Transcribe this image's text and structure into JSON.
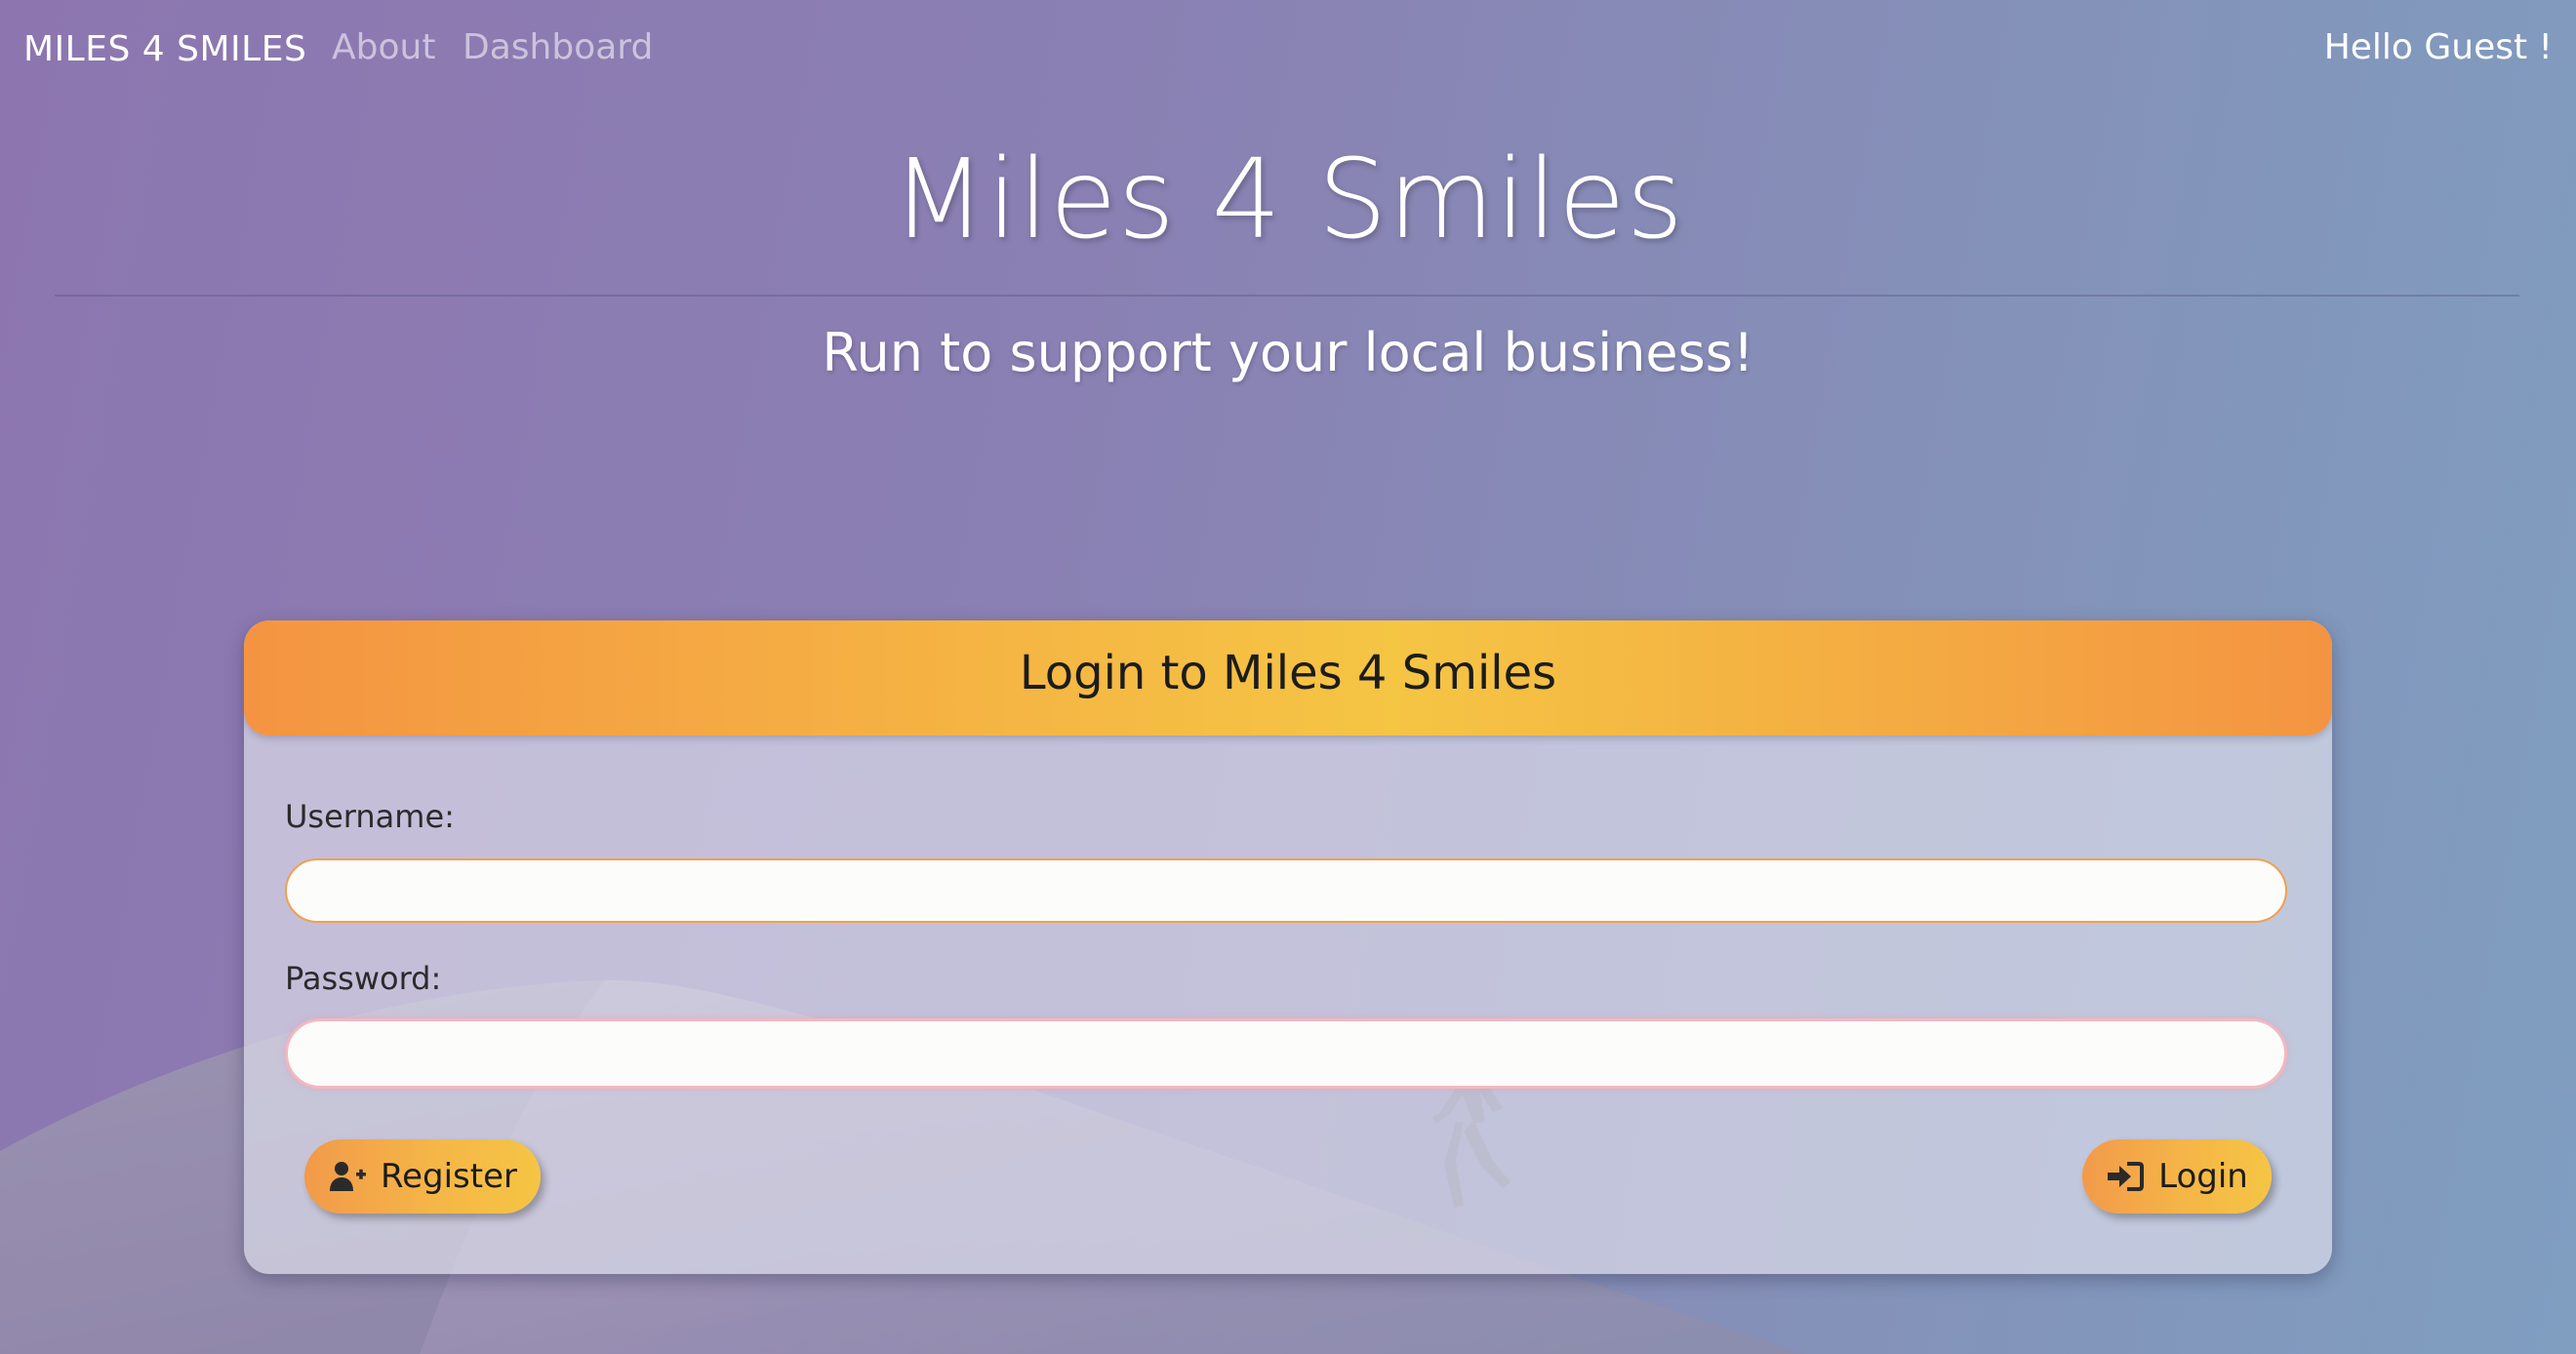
{
  "navbar": {
    "brand": "MILES 4 SMILES",
    "links": [
      {
        "label": "About"
      },
      {
        "label": "Dashboard"
      }
    ],
    "greeting": "Hello Guest !"
  },
  "hero": {
    "title": "Miles 4 Smiles",
    "subtitle": "Run to support your local business!"
  },
  "login_card": {
    "title": "Login to Miles 4 Smiles",
    "username_label": "Username:",
    "username_value": "",
    "password_label": "Password:",
    "password_value": "",
    "register_button": {
      "label": "Register",
      "icon": "user-plus-icon"
    },
    "login_button": {
      "label": "Login",
      "icon": "sign-in-icon"
    }
  },
  "colors": {
    "accent_orange": "#f49442",
    "accent_yellow": "#f5c544",
    "background_purple": "#8d76b0",
    "background_blue": "#7f9ec0"
  }
}
